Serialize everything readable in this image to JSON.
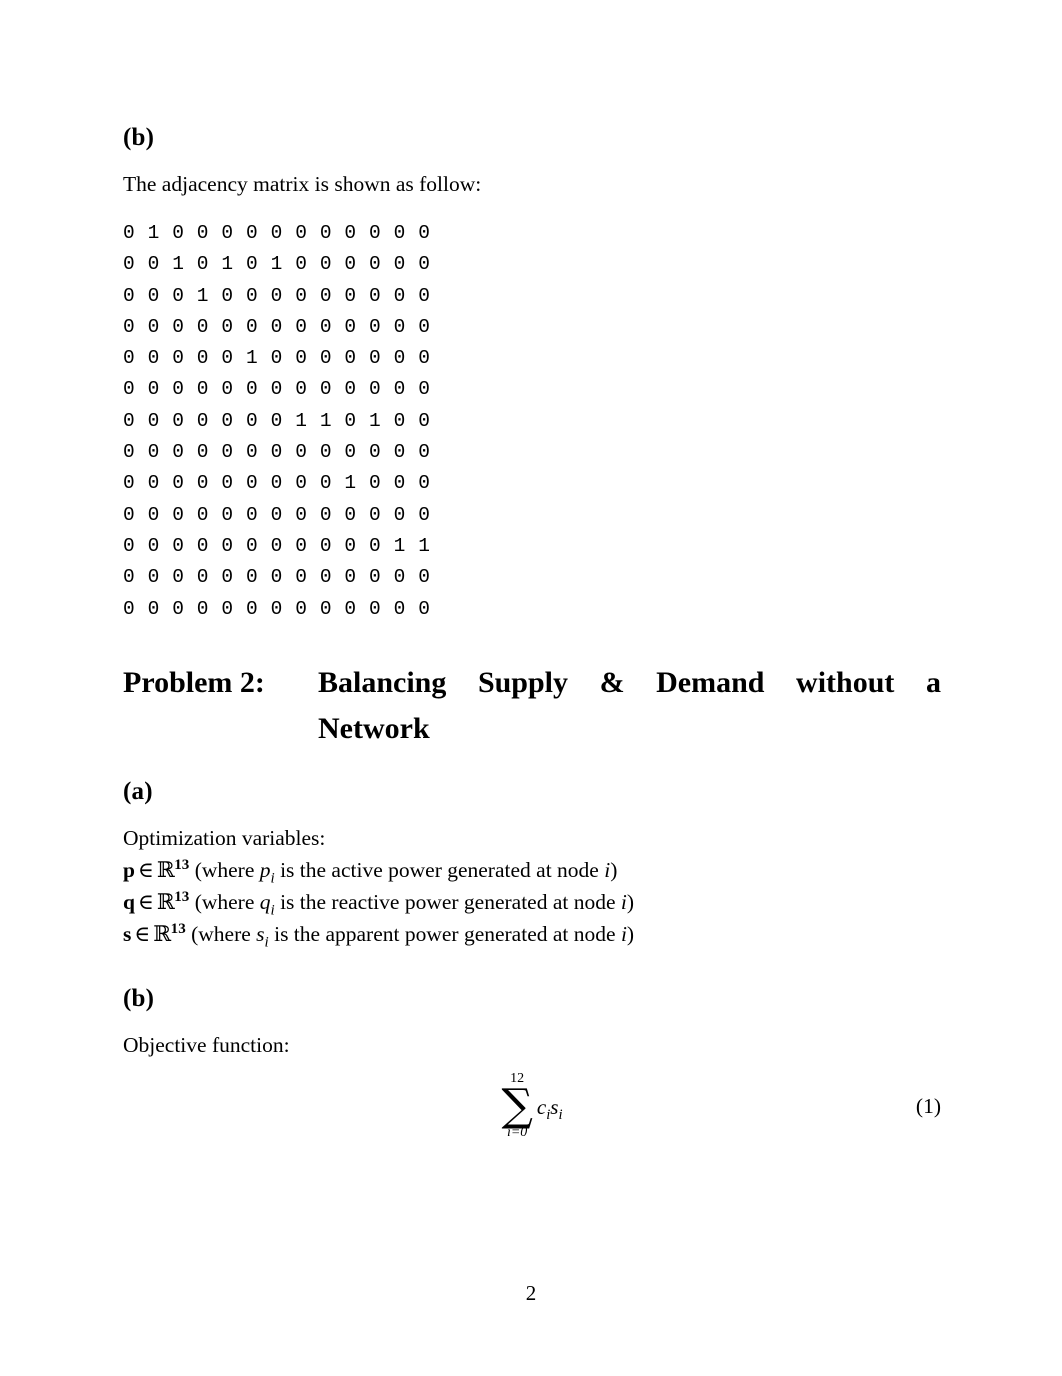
{
  "document": {
    "page_number": "2"
  },
  "section_b_matrix": {
    "label": "(b)",
    "intro_text": "The adjacency matrix is shown as follow:",
    "matrix_rows": [
      "0 1 0 0 0 0 0 0 0 0 0 0 0",
      "0 0 1 0 1 0 1 0 0 0 0 0 0",
      "0 0 0 1 0 0 0 0 0 0 0 0 0",
      "0 0 0 0 0 0 0 0 0 0 0 0 0",
      "0 0 0 0 0 1 0 0 0 0 0 0 0",
      "0 0 0 0 0 0 0 0 0 0 0 0 0",
      "0 0 0 0 0 0 0 1 1 0 1 0 0",
      "0 0 0 0 0 0 0 0 0 0 0 0 0",
      "0 0 0 0 0 0 0 0 0 1 0 0 0",
      "0 0 0 0 0 0 0 0 0 0 0 0 0",
      "0 0 0 0 0 0 0 0 0 0 0 1 1",
      "0 0 0 0 0 0 0 0 0 0 0 0 0",
      "0 0 0 0 0 0 0 0 0 0 0 0 0"
    ]
  },
  "problem2": {
    "heading_tag": "Problem 2:",
    "heading_line1_words": [
      "Balancing",
      "Supply",
      "&",
      "Demand",
      "without",
      "a"
    ],
    "heading_line2": "Network",
    "part_a": {
      "label": "(a)",
      "intro_text": "Optimization variables:",
      "variables": [
        {
          "symbol": "p",
          "member_of": "∈",
          "space": "ℝ",
          "dimension": "13",
          "open_paren": "(where",
          "component": "p",
          "component_sub": "i",
          "description": "is the active power generated at node",
          "index": "i",
          "close_paren": ")"
        },
        {
          "symbol": "q",
          "member_of": "∈",
          "space": "ℝ",
          "dimension": "13",
          "open_paren": "(where",
          "component": "q",
          "component_sub": "i",
          "description": "is the reactive power generated at node",
          "index": "i",
          "close_paren": ")"
        },
        {
          "symbol": "s",
          "member_of": "∈",
          "space": "ℝ",
          "dimension": "13",
          "open_paren": "(where",
          "component": "s",
          "component_sub": "i",
          "description": "is the apparent power generated at node",
          "index": "i",
          "close_paren": ")"
        }
      ]
    },
    "part_b": {
      "label": "(b)",
      "intro_text": "Objective function:",
      "equation": {
        "sigma": "∑",
        "upper_limit": "12",
        "lower_limit": "i=0",
        "summand_c": "c",
        "summand_c_sub": "i",
        "summand_s": "s",
        "summand_s_sub": "i",
        "number": "(1)"
      }
    }
  }
}
